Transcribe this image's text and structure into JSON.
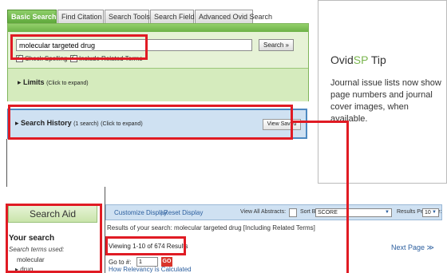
{
  "tabs": [
    {
      "label": "Basic Search",
      "active": true
    },
    {
      "label": "Find Citation",
      "active": false
    },
    {
      "label": "Search Tools",
      "active": false
    },
    {
      "label": "Search Fields",
      "active": false
    },
    {
      "label": "Advanced Ovid Search",
      "active": false
    }
  ],
  "search": {
    "query": "molecular targeted drug",
    "button_label": "Search »",
    "check_spelling_label": "Check Spelling",
    "include_related_label": "Include Related Terms",
    "limits_label": "Limits",
    "limits_hint": "(Click to expand)"
  },
  "history": {
    "label": "Search History",
    "count_text": "(1 search)",
    "hint": "(Click to expand)",
    "view_saved_label": "View Saved"
  },
  "tip": {
    "brand_prefix": "Ovid",
    "brand_highlight": "SP",
    "brand_suffix": " Tip",
    "body": "Journal issue lists now show page numbers and journal cover images, when available."
  },
  "search_aid": {
    "title": "Search Aid",
    "your_search": "Your search",
    "terms_used_label": "Search terms used:",
    "terms": [
      "molecular",
      "drug"
    ]
  },
  "results": {
    "customize_display": "Customize Display",
    "reset_display": "Reset Display",
    "view_all_abstracts": "View All Abstracts:",
    "sort_by_label": "Sort By:",
    "sort_by_value": "SCORE",
    "per_page_label": "Results Per Page:",
    "per_page_value": "10",
    "results_of": "Results of your search: molecular targeted drug [Including Related Terms]",
    "viewing": "Viewing 1-10 of 674 Results",
    "next_page": "Next Page ≫",
    "goto_label": "Go to #:",
    "goto_value": "1",
    "go_button": "GO",
    "relevancy_link": "How Relevancy is Calculated"
  },
  "colors": {
    "annotation_red": "#e01b24",
    "tab_green": "#6db147",
    "panel_green": "#e6f2d6",
    "bar_blue": "#cfe1f2",
    "link_blue": "#2b5e9e",
    "ovid_accent": "#7ab54e"
  }
}
